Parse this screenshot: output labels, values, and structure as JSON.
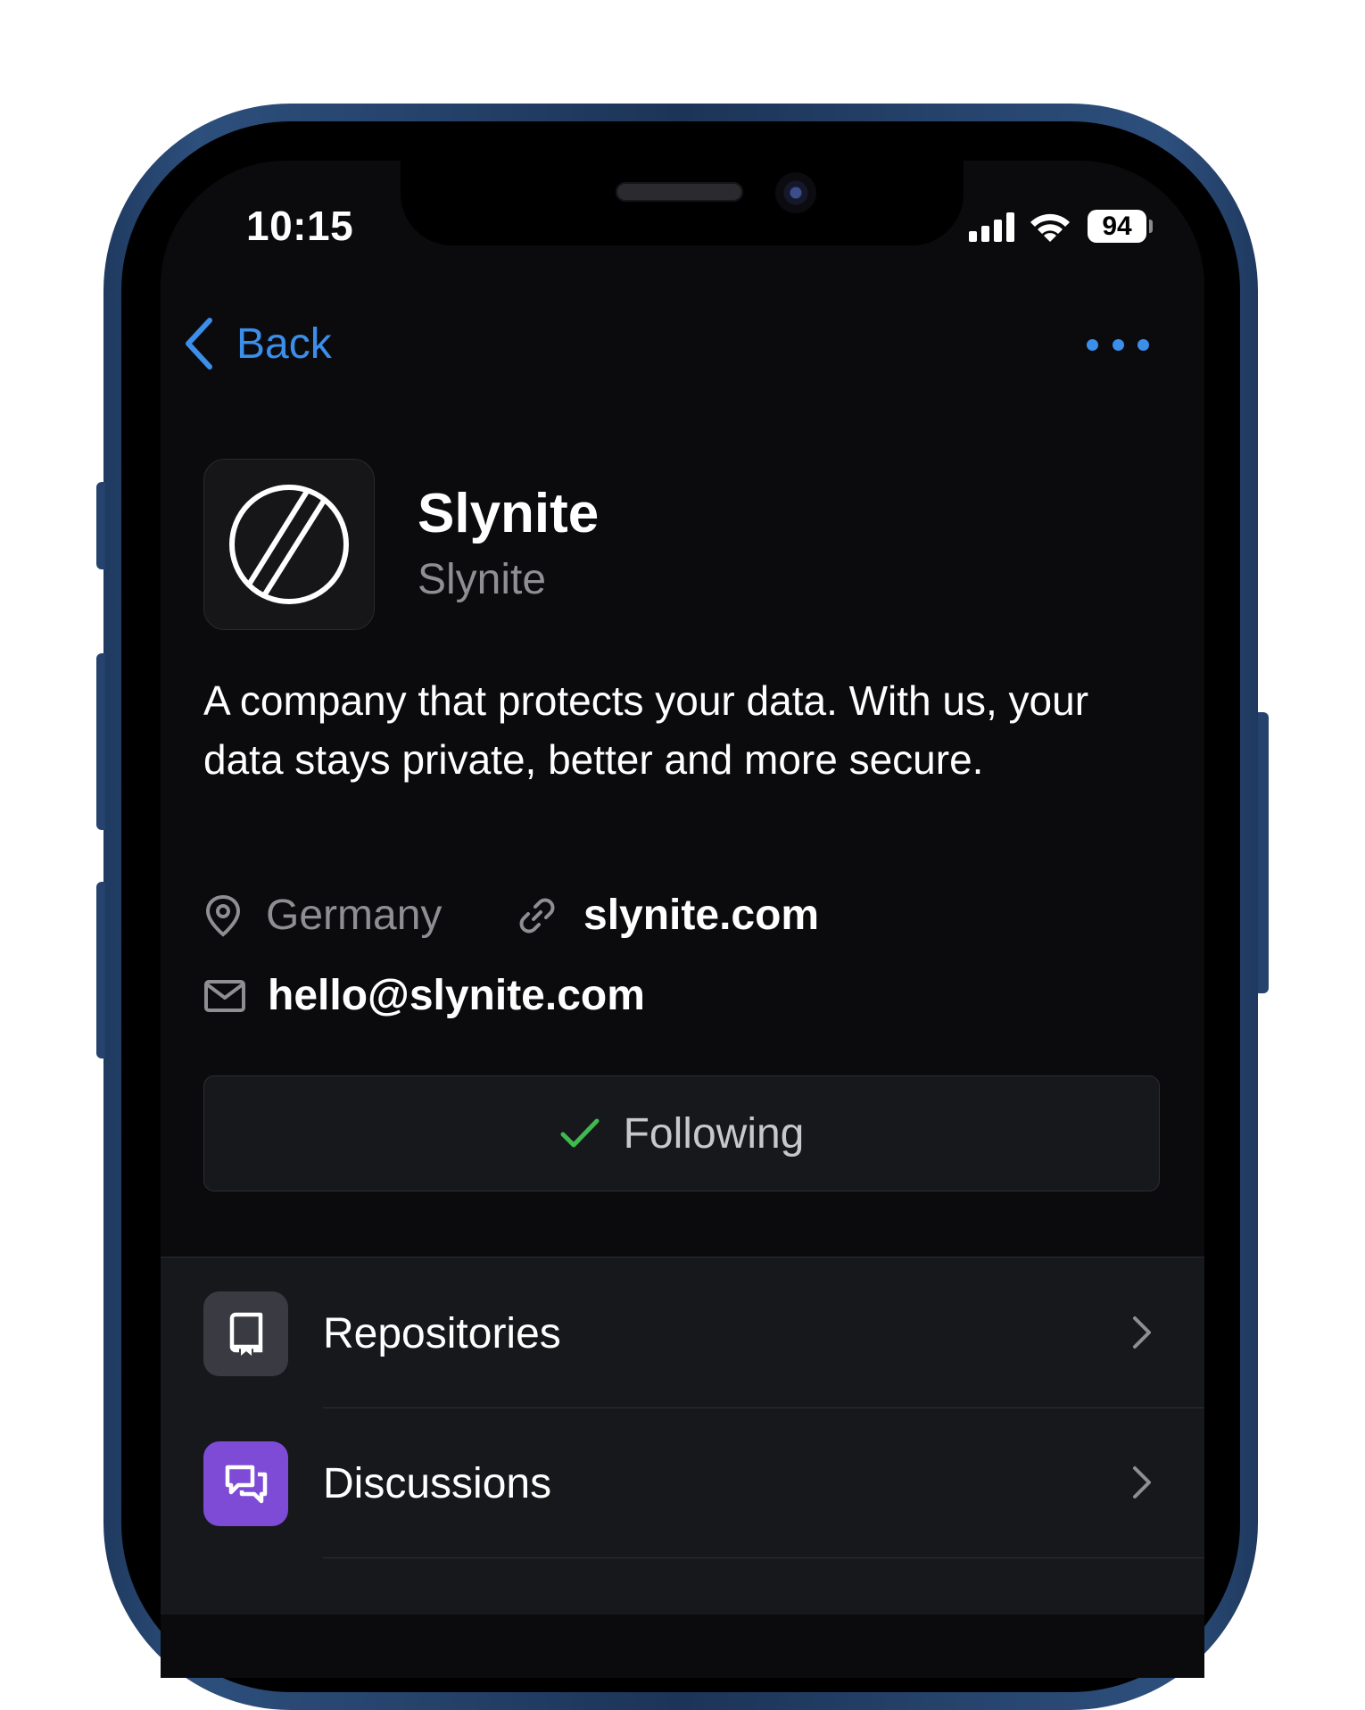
{
  "status_bar": {
    "time": "10:15",
    "battery": "94"
  },
  "nav": {
    "back_label": "Back",
    "more_icon": "more-horizontal-icon"
  },
  "profile": {
    "name": "Slynite",
    "login": "Slynite",
    "bio": "A company that protects your data. With us, your data stays private, better and more secure.",
    "location": "Germany",
    "website": "slynite.com",
    "email": "hello@slynite.com"
  },
  "follow": {
    "label": "Following",
    "check_color": "#3fb950"
  },
  "menu": {
    "items": [
      {
        "label": "Repositories",
        "icon": "repo-icon",
        "icon_bg": "#3a3b42"
      },
      {
        "label": "Discussions",
        "icon": "discussion-icon",
        "icon_bg": "#7d4bd6"
      }
    ]
  },
  "colors": {
    "accent": "#3b8eea",
    "background": "#0b0b0d",
    "secondary_text": "#8e8e93"
  }
}
